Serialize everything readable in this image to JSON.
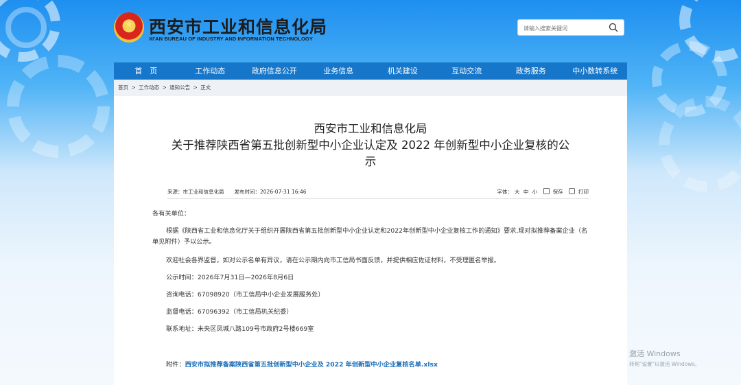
{
  "header": {
    "emblem_char": "★",
    "title": "西安市工业和信息化局",
    "subtitle": "XI'AN BUREAU OF INDUSTRY AND INFORMATION TECHNOLOGY",
    "search_placeholder": "请输入搜索关键词"
  },
  "nav": [
    "首　页",
    "工作动态",
    "政府信息公开",
    "业务信息",
    "机关建设",
    "互动交流",
    "政务服务",
    "中小数转系统"
  ],
  "breadcrumb": [
    "首页",
    "工作动态",
    "通知公告",
    "正文"
  ],
  "breadcrumb_sep": ">",
  "article": {
    "title_line1": "西安市工业和信息化局",
    "title_line2": "关于推荐陕西省第五批创新型中小企业认定及 2022 年创新型中小企业复核的公",
    "title_line3": "示",
    "source": "来源：市工业和信息化局　　发布时间：2026-07-31 16:46",
    "font_label": "字体：",
    "font_sizes": [
      "大",
      "中",
      "小"
    ],
    "save_label": "保存",
    "print_label": "打印",
    "salutation": "各有关单位：",
    "para1": "根据《陕西省工业和信息化厅关于组织开展陕西省第五批创新型中小企业认定和2022年创新型中小企业复核工作的通知》要求,现对拟推荐备案企业（名单见附件）予以公示。",
    "para2": "欢迎社会各界监督，如对公示名单有异议，请在公示期内向市工信局书面反馈，并提供相应佐证材料，不受理匿名举报。",
    "period": "公示时间：2026年7月31日—2026年8月6日",
    "consult": "咨询电话：67098920（市工信局中小企业发展服务处）",
    "supervise": "监督电话：67096392（市工信局机关纪委）",
    "address": "联系地址：未央区凤城八路109号市政府2号楼669室",
    "attachment_label": "附件：",
    "attachment_link": "西安市拟推荐备案陕西省第五批创新型中小企业及 2022 年创新型中小企业复核名单.xlsx"
  },
  "watermark": {
    "line1": "激活 Windows",
    "line2": "转到\"设置\"以激活 Windows。"
  }
}
